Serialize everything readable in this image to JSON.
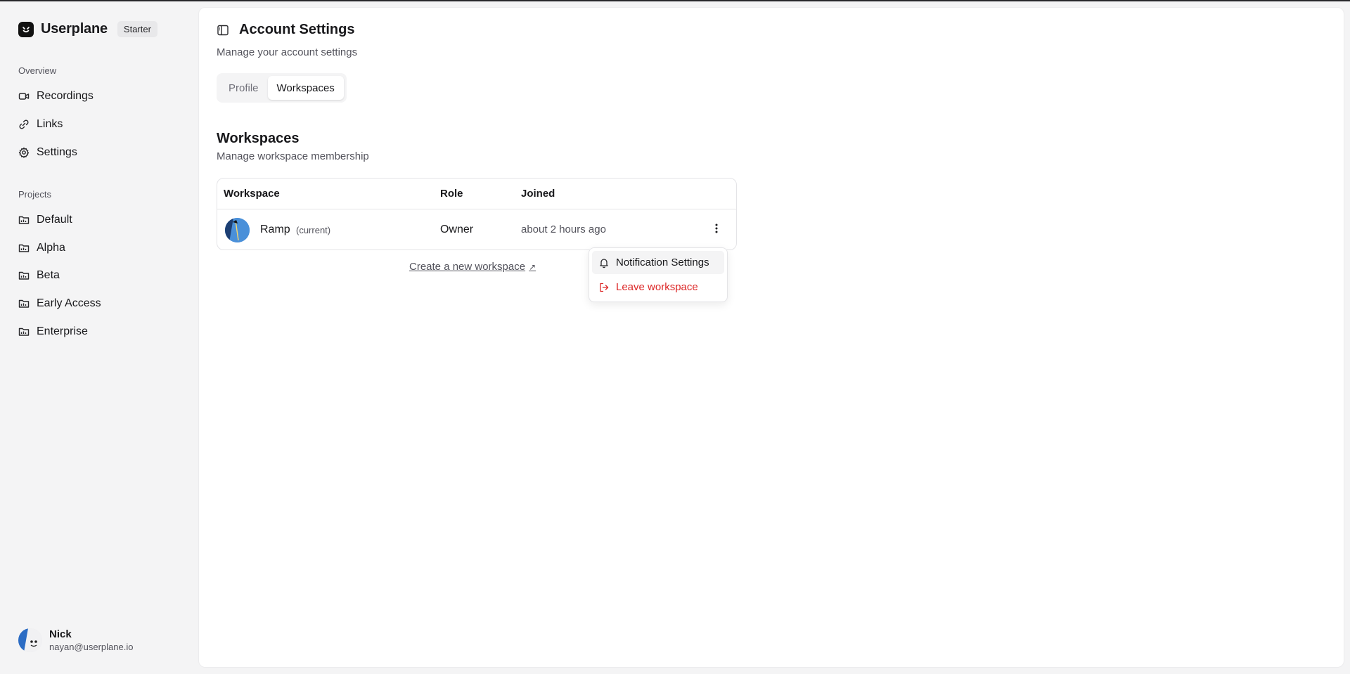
{
  "app": {
    "brand_name": "Userplane",
    "plan": "Starter"
  },
  "sidebar": {
    "overview_label": "Overview",
    "overview_items": [
      {
        "label": "Recordings",
        "icon": "video-icon"
      },
      {
        "label": "Links",
        "icon": "link-icon"
      },
      {
        "label": "Settings",
        "icon": "gear-icon"
      }
    ],
    "projects_label": "Projects",
    "projects": [
      {
        "label": "Default",
        "icon": "folder-icon"
      },
      {
        "label": "Alpha",
        "icon": "folder-icon"
      },
      {
        "label": "Beta",
        "icon": "folder-icon"
      },
      {
        "label": "Early Access",
        "icon": "folder-icon"
      },
      {
        "label": "Enterprise",
        "icon": "folder-icon"
      }
    ]
  },
  "user": {
    "name": "Nick",
    "email": "nayan@userplane.io"
  },
  "header": {
    "title": "Account Settings",
    "subtitle": "Manage your account settings"
  },
  "tabs": [
    {
      "label": "Profile",
      "active": false
    },
    {
      "label": "Workspaces",
      "active": true
    }
  ],
  "workspaces": {
    "title": "Workspaces",
    "subtitle": "Manage workspace membership",
    "columns": [
      "Workspace",
      "Role",
      "Joined"
    ],
    "rows": [
      {
        "name": "Ramp",
        "tag": "(current)",
        "role": "Owner",
        "joined": "about 2 hours ago"
      }
    ],
    "create_link": "Create a new workspace",
    "create_link_arrow": "↗"
  },
  "menu": {
    "items": [
      {
        "label": "Notification Settings",
        "icon": "bell-icon"
      },
      {
        "label": "Leave workspace",
        "icon": "logout-icon"
      }
    ]
  },
  "colors": {
    "background": "#f4f4f5",
    "panel": "#ffffff",
    "danger": "#dc2626",
    "avatar_blue": "#4a90d9"
  }
}
